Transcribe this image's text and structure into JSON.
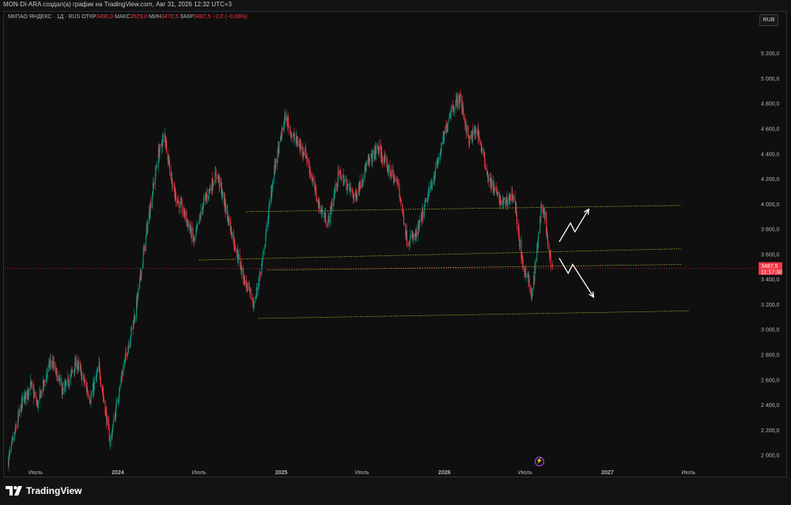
{
  "header": {
    "credit": "MON-DI-ARA создал(а) график на TradingView.com, Авг 31, 2026 12:32 UTC+3"
  },
  "legend": {
    "symbol": "МКПАО ЯНДЕКС · 1Д · RUS",
    "open_label": "ОТКР",
    "open_value": "3490,0",
    "high_label": "МАКС",
    "high_value": "3529,0",
    "low_label": "МИН",
    "low_value": "3470,5",
    "close_label": "ЗАКР",
    "close_value": "3487,5",
    "change_value": "−2,0 (−0,06%)"
  },
  "currency_button": "RUB",
  "price_tag": {
    "price": "3487,5",
    "countdown": "11:17:30"
  },
  "footer": {
    "logo_text": "TradingView"
  },
  "icons": {
    "logo": "tradingview-logo-icon",
    "flash": "lightning-icon"
  },
  "colors": {
    "background": "#0f0f0f",
    "up": "#089981",
    "down": "#f23645",
    "level": "#c8c832",
    "price_line": "#f23645",
    "arrow": "#ffffff",
    "flash": "#a64dff"
  },
  "chart_data": {
    "type": "candlestick",
    "symbol": "МКПАО ЯНДЕКС",
    "interval": "1Д",
    "currency": "RUB",
    "x_tick_labels": [
      "Июль",
      "2024",
      "Июль",
      "2025",
      "Июль",
      "2026",
      "Июль",
      "2027",
      "Июль"
    ],
    "x_ticks_at": [
      "2023-07-01",
      "2024-01-01",
      "2024-07-01",
      "2025-01-01",
      "2025-07-01",
      "2026-01-01",
      "2026-07-01",
      "2027-01-01",
      "2027-07-01"
    ],
    "y_ticks": [
      2000,
      2200,
      2400,
      2600,
      2800,
      3000,
      3200,
      3400,
      3600,
      3800,
      4000,
      4200,
      4400,
      4600,
      4800,
      5000,
      5200
    ],
    "y_tick_labels": [
      "2 000,0",
      "2 200,0",
      "2 400,0",
      "2 600,0",
      "2 800,0",
      "3 000,0",
      "3 200,0",
      "3 400,0",
      "3 600,0",
      "3 800,0",
      "4 000,0",
      "4 200,0",
      "4 400,0",
      "4 600,0",
      "4 800,0",
      "5 000,0",
      "5 200,0"
    ],
    "x_range": [
      "2023-04-23",
      "2027-11-28"
    ],
    "y_range": [
      1900,
      5500
    ],
    "grid": false,
    "price_path": [
      [
        "2023-05-01",
        1960
      ],
      [
        "2023-06-01",
        2420
      ],
      [
        "2023-06-20",
        2560
      ],
      [
        "2023-07-05",
        2400
      ],
      [
        "2023-08-05",
        2760
      ],
      [
        "2023-09-01",
        2500
      ],
      [
        "2023-10-01",
        2740
      ],
      [
        "2023-11-01",
        2450
      ],
      [
        "2023-11-20",
        2700
      ],
      [
        "2023-12-15",
        2100
      ],
      [
        "2024-01-10",
        2640
      ],
      [
        "2024-02-10",
        3150
      ],
      [
        "2024-03-10",
        3900
      ],
      [
        "2024-04-01",
        4400
      ],
      [
        "2024-04-15",
        4550
      ],
      [
        "2024-05-05",
        4100
      ],
      [
        "2024-06-01",
        3900
      ],
      [
        "2024-06-20",
        3700
      ],
      [
        "2024-07-10",
        4000
      ],
      [
        "2024-08-10",
        4250
      ],
      [
        "2024-09-10",
        3800
      ],
      [
        "2024-10-10",
        3400
      ],
      [
        "2024-11-01",
        3200
      ],
      [
        "2024-11-20",
        3550
      ],
      [
        "2024-12-15",
        4250
      ],
      [
        "2025-01-10",
        4700
      ],
      [
        "2025-01-25",
        4550
      ],
      [
        "2025-02-25",
        4400
      ],
      [
        "2025-03-25",
        4000
      ],
      [
        "2025-04-15",
        3850
      ],
      [
        "2025-05-10",
        4250
      ],
      [
        "2025-06-15",
        4050
      ],
      [
        "2025-07-10",
        4300
      ],
      [
        "2025-08-05",
        4450
      ],
      [
        "2025-08-25",
        4300
      ],
      [
        "2025-09-20",
        4150
      ],
      [
        "2025-10-10",
        3700
      ],
      [
        "2025-10-30",
        3750
      ],
      [
        "2025-11-20",
        4000
      ],
      [
        "2025-12-15",
        4300
      ],
      [
        "2026-01-15",
        4750
      ],
      [
        "2026-02-05",
        4850
      ],
      [
        "2026-02-25",
        4500
      ],
      [
        "2026-03-15",
        4600
      ],
      [
        "2026-04-10",
        4200
      ],
      [
        "2026-05-10",
        4000
      ],
      [
        "2026-06-05",
        4080
      ],
      [
        "2026-06-25",
        3500
      ],
      [
        "2026-07-05",
        3450
      ],
      [
        "2026-07-15",
        3250
      ],
      [
        "2026-07-25",
        3550
      ],
      [
        "2026-08-05",
        3950
      ],
      [
        "2026-08-15",
        3900
      ],
      [
        "2026-08-22",
        3600
      ],
      [
        "2026-08-31",
        3487.5
      ]
    ],
    "last_price": 3487.5,
    "horizontal_levels": [
      {
        "from": [
          "2024-10-15",
          3940
        ],
        "to": [
          "2027-06-15",
          3990
        ]
      },
      {
        "from": [
          "2024-07-01",
          3555
        ],
        "to": [
          "2027-06-15",
          3645
        ]
      },
      {
        "from": [
          "2024-12-01",
          3475
        ],
        "to": [
          "2027-06-15",
          3520
        ]
      },
      {
        "from": [
          "2024-11-10",
          3090
        ],
        "to": [
          "2027-07-01",
          3150
        ]
      }
    ],
    "scenario_arrows": [
      {
        "direction": "up",
        "path": [
          [
            "2026-09-15",
            3700
          ],
          [
            "2026-10-10",
            3850
          ],
          [
            "2026-10-20",
            3780
          ],
          [
            "2026-11-20",
            3960
          ]
        ]
      },
      {
        "direction": "down",
        "path": [
          [
            "2026-09-15",
            3570
          ],
          [
            "2026-10-05",
            3450
          ],
          [
            "2026-10-15",
            3520
          ],
          [
            "2026-12-01",
            3260
          ]
        ]
      }
    ]
  }
}
